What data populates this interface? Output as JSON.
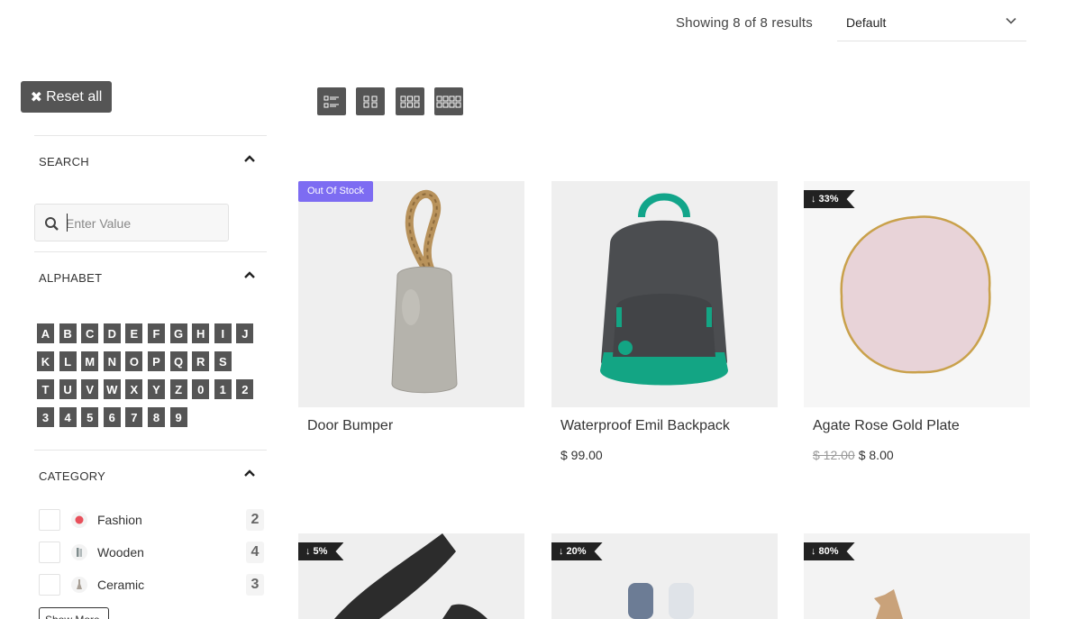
{
  "toolbar": {
    "results_text": "Showing 8 of 8 results",
    "sort_value": "Default"
  },
  "filters": {
    "reset_label": "Reset all",
    "search": {
      "title": "SEARCH",
      "placeholder": "Enter Value",
      "value": ""
    },
    "alphabet": {
      "title": "ALPHABET",
      "rows": [
        [
          "A",
          "B",
          "C",
          "D",
          "E",
          "F",
          "G",
          "H",
          "I",
          "J"
        ],
        [
          "K",
          "L",
          "M",
          "N",
          "O",
          "P",
          "Q",
          "R",
          "S"
        ],
        [
          "T",
          "U",
          "V",
          "W",
          "X",
          "Y",
          "Z",
          "0",
          "1",
          "2"
        ],
        [
          "3",
          "4",
          "5",
          "6",
          "7",
          "8",
          "9"
        ]
      ]
    },
    "category": {
      "title": "CATEGORY",
      "items": [
        {
          "label": "Fashion",
          "count": "2"
        },
        {
          "label": "Wooden",
          "count": "4"
        },
        {
          "label": "Ceramic",
          "count": "3"
        }
      ],
      "show_more": "Show More"
    }
  },
  "view_modes": [
    "list-view-icon",
    "grid-2-icon",
    "grid-3-icon",
    "grid-4-icon"
  ],
  "products": [
    {
      "name": "Door Bumper",
      "price": "",
      "old_price": "",
      "badge": "Out Of Stock",
      "badge_type": "oos"
    },
    {
      "name": "Waterproof Emil Backpack",
      "price": "$ 99.00",
      "old_price": "",
      "badge": "",
      "badge_type": ""
    },
    {
      "name": "Agate Rose Gold Plate",
      "price": "$ 8.00",
      "old_price": "$ 12.00",
      "badge": "↓ 33%",
      "badge_type": "sale"
    },
    {
      "name": "",
      "price": "",
      "old_price": "",
      "badge": "↓ 5%",
      "badge_type": "sale"
    },
    {
      "name": "",
      "price": "",
      "old_price": "",
      "badge": "↓ 20%",
      "badge_type": "sale"
    },
    {
      "name": "",
      "price": "",
      "old_price": "",
      "badge": "↓ 80%",
      "badge_type": "sale"
    }
  ],
  "colors": {
    "accent_dark": "#555555",
    "out_of_stock_badge": "#7d6cf2",
    "sale_badge": "#222222"
  }
}
